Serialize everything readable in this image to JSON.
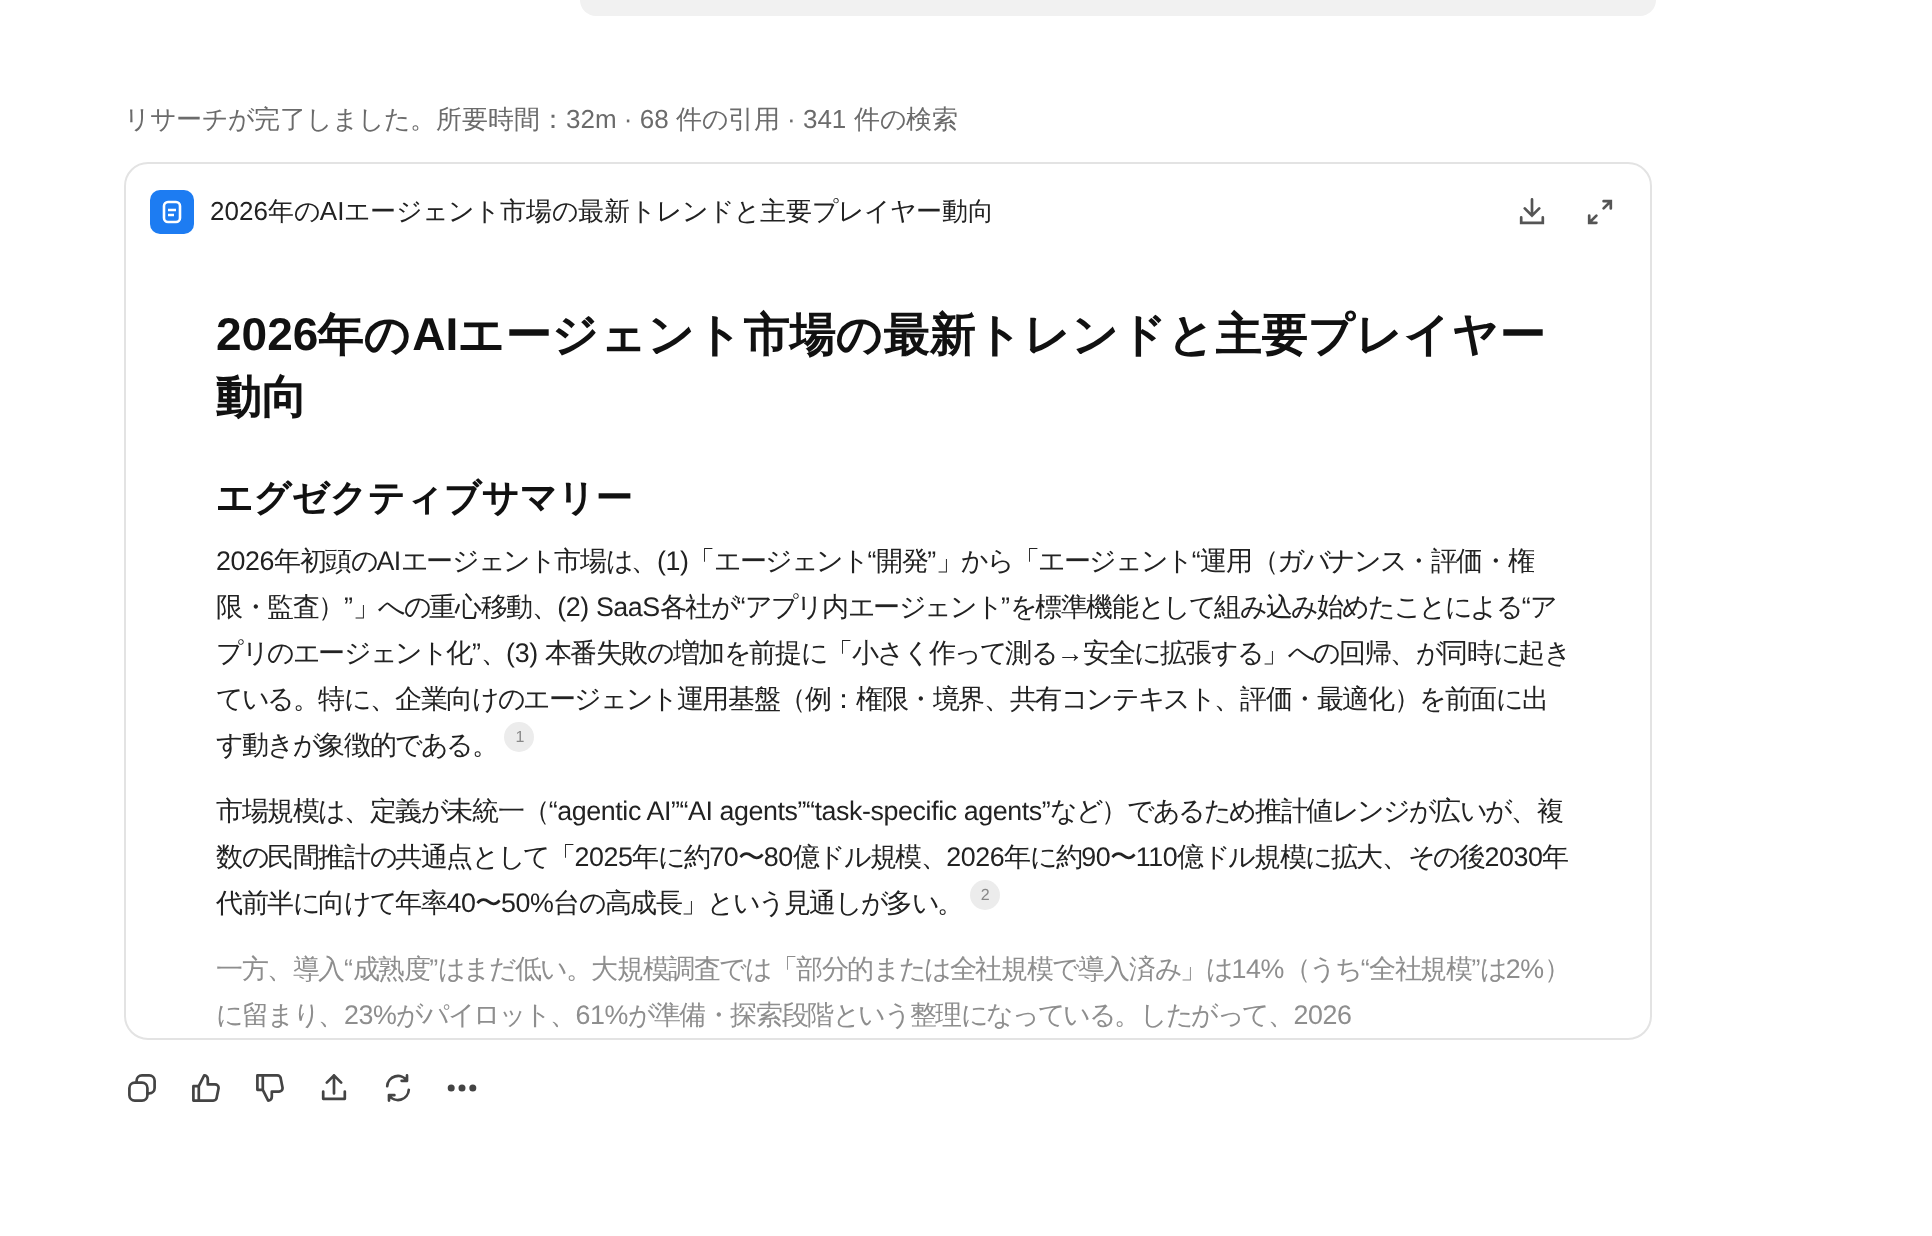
{
  "status": "リサーチが完了しました。所要時間：32m · 68 件の引用 · 341 件の検索",
  "document": {
    "title": "2026年のAIエージェント市場の最新トレンドと主要プレイヤー動向",
    "heading": "2026年のAIエージェント市場の最新トレンドと主要プレイヤー動向",
    "section": "エグゼクティブサマリー",
    "paragraphs": [
      {
        "text": "2026年初頭のAIエージェント市場は、(1)「エージェント“開発”」から「エージェント“運用（ガバナンス・評価・権限・監査）”」への重心移動、(2) SaaS各社が“アプリ内エージェント”を標準機能として組み込み始めたことによる“アプリのエージェント化”、(3) 本番失敗の増加を前提に「小さく作って測る→安全に拡張する」への回帰、が同時に起きている。特に、企業向けのエージェント運用基盤（例：権限・境界、共有コンテキスト、評価・最適化）を前面に出す動きが象徴的である。",
        "citation": "1"
      },
      {
        "text": "市場規模は、定義が未統一（“agentic AI”“AI agents”“task-specific agents”など）であるため推計値レンジが広いが、複数の民間推計の共通点として「2025年に約70〜80億ドル規模、2026年に約90〜110億ドル規模に拡大、その後2030年代前半に向けて年率40〜50%台の高成長」という見通しが多い。",
        "citation": "2"
      },
      {
        "text": "一方、導入“成熟度”はまだ低い。大規模調査では「部分的または全社規模で導入済み」は14%（うち“全社規模”は2%）に留まり、23%がパイロット、61%が準備・探索段階という整理になっている。したがって、2026"
      }
    ]
  },
  "actions": [
    {
      "kind": "copy"
    },
    {
      "kind": "like"
    },
    {
      "kind": "dislike"
    },
    {
      "kind": "share"
    },
    {
      "kind": "retry"
    },
    {
      "kind": "more"
    }
  ]
}
